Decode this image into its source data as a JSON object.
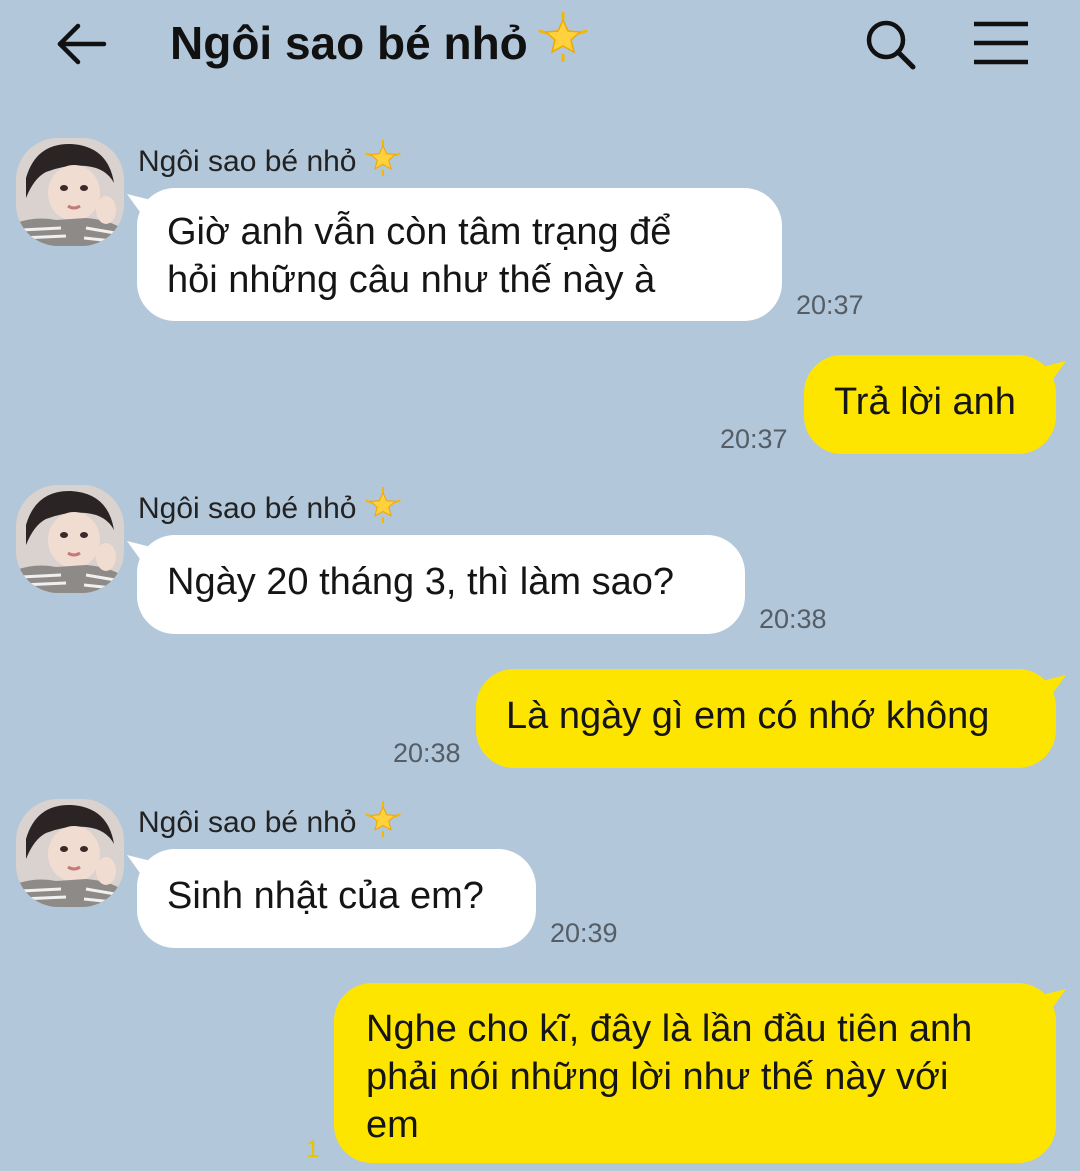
{
  "header": {
    "title": "Ngôi sao bé nhỏ",
    "title_emoji": "🌟"
  },
  "messages": [
    {
      "direction": "in",
      "sender": "Ngôi sao bé nhỏ",
      "sender_emoji": "🌟",
      "text_lines": [
        "Giờ anh vẫn còn tâm trạng để",
        "hỏi những câu như thế này à"
      ],
      "time": "20:37"
    },
    {
      "direction": "out",
      "text_lines": [
        "Trả lời anh"
      ],
      "time": "20:37"
    },
    {
      "direction": "in",
      "sender": "Ngôi sao bé nhỏ",
      "sender_emoji": "🌟",
      "text_lines": [
        "Ngày 20 tháng 3, thì làm sao?"
      ],
      "time": "20:38"
    },
    {
      "direction": "out",
      "text_lines": [
        "Là ngày gì em có nhớ không"
      ],
      "time": "20:38"
    },
    {
      "direction": "in",
      "sender": "Ngôi sao bé nhỏ",
      "sender_emoji": "🌟",
      "text_lines": [
        "Sinh nhật của em?"
      ],
      "time": "20:39"
    },
    {
      "direction": "out",
      "text_lines": [
        "Nghe cho kĩ, đây là lần đầu tiên anh",
        "phải nói những lời như thế này với",
        "em"
      ],
      "unread": "1"
    }
  ],
  "colors": {
    "background": "#b2c7da",
    "incoming_bubble": "#ffffff",
    "outgoing_bubble": "#fee500"
  }
}
